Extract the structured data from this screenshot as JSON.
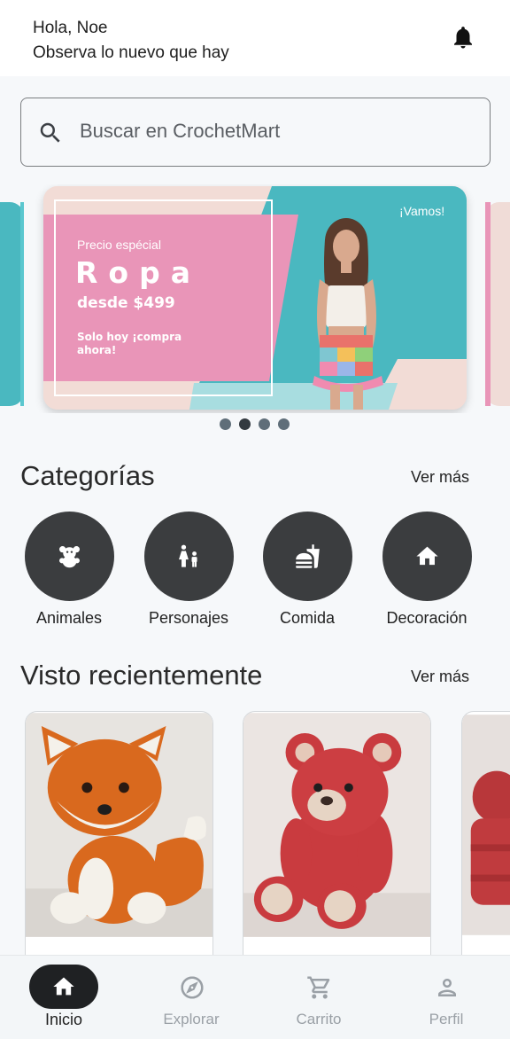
{
  "header": {
    "greeting": "Hola, Noe",
    "subtitle": "Observa lo nuevo que hay",
    "notification_icon": "bell-icon"
  },
  "search": {
    "placeholder": "Buscar en CrochetMart",
    "icon": "search-icon"
  },
  "banner": {
    "special": "Precio espécial",
    "headline": "Ropa",
    "price": "desde $499",
    "cta": "Solo hoy ¡compra ahora!",
    "tag": "¡Vamos!",
    "colors": {
      "pink": "#e995b8",
      "teal": "#4ab8c0",
      "cream": "#f2dcd6"
    }
  },
  "carousel": {
    "total_slides": 4,
    "active_index": 1
  },
  "categories": {
    "title": "Categorías",
    "more": "Ver más",
    "items": [
      {
        "label": "Animales",
        "icon": "teddy-bear-icon"
      },
      {
        "label": "Personajes",
        "icon": "family-icon"
      },
      {
        "label": "Comida",
        "icon": "fastfood-icon"
      },
      {
        "label": "Decoración",
        "icon": "home-icon"
      }
    ]
  },
  "recent": {
    "title": "Visto recientemente",
    "more": "Ver más",
    "items": [
      {
        "image": "crochet-fox"
      },
      {
        "image": "crochet-red-bear"
      },
      {
        "image": "crochet-red-item"
      }
    ]
  },
  "nav": {
    "items": [
      {
        "label": "Inicio",
        "icon": "home-icon",
        "active": true
      },
      {
        "label": "Explorar",
        "icon": "compass-icon",
        "active": false
      },
      {
        "label": "Carrito",
        "icon": "cart-icon",
        "active": false
      },
      {
        "label": "Perfil",
        "icon": "person-icon",
        "active": false
      }
    ]
  }
}
